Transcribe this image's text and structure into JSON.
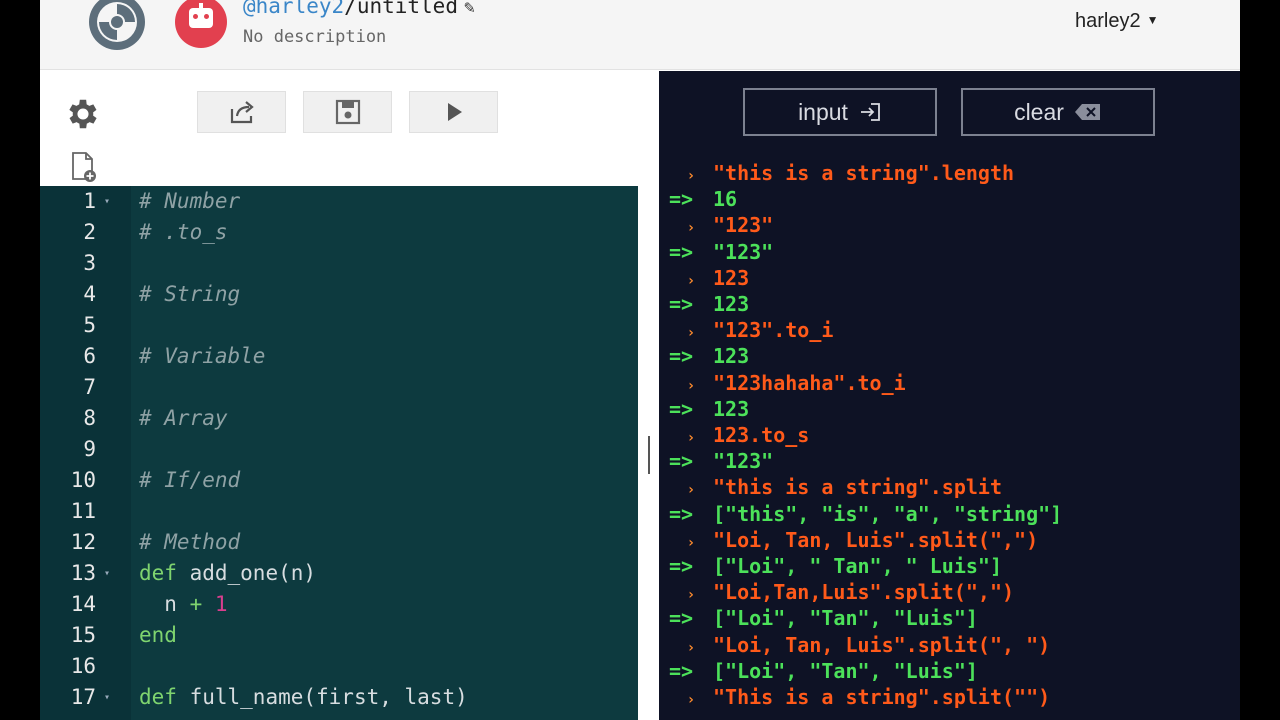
{
  "header": {
    "owner": "@harley2",
    "separator": "/",
    "repl_name": "untitled",
    "description": "No description",
    "username": "harley2"
  },
  "icons": {
    "logo": "logo-icon",
    "avatar": "robot-avatar-icon",
    "edit": "pencil-icon",
    "settings": "gear-icon",
    "new_file": "new-file-icon",
    "share": "share-icon",
    "save": "save-icon",
    "run": "play-icon",
    "input": "input-icon",
    "clear": "backspace-icon"
  },
  "colors": {
    "editor_bg": "#0d3a3f",
    "console_bg": "#0e1225",
    "console_input": "#ff5a1a",
    "console_output": "#4ce15a",
    "avatar": "#e2404f",
    "user_link": "#3a86c8"
  },
  "console_buttons": {
    "input_label": "input",
    "clear_label": "clear"
  },
  "editor": {
    "lines": [
      {
        "n": "1",
        "fold": true,
        "tokens": [
          {
            "t": "# Number",
            "c": "cmt"
          }
        ]
      },
      {
        "n": "2",
        "fold": false,
        "tokens": [
          {
            "t": "# .to_s",
            "c": "cmt"
          }
        ]
      },
      {
        "n": "3",
        "fold": false,
        "tokens": []
      },
      {
        "n": "4",
        "fold": false,
        "tokens": [
          {
            "t": "# String",
            "c": "cmt"
          }
        ]
      },
      {
        "n": "5",
        "fold": false,
        "tokens": []
      },
      {
        "n": "6",
        "fold": false,
        "tokens": [
          {
            "t": "# Variable",
            "c": "cmt"
          }
        ]
      },
      {
        "n": "7",
        "fold": false,
        "tokens": []
      },
      {
        "n": "8",
        "fold": false,
        "tokens": [
          {
            "t": "# Array",
            "c": "cmt"
          }
        ]
      },
      {
        "n": "9",
        "fold": false,
        "tokens": []
      },
      {
        "n": "10",
        "fold": false,
        "tokens": [
          {
            "t": "# If/end",
            "c": "cmt"
          }
        ]
      },
      {
        "n": "11",
        "fold": false,
        "tokens": []
      },
      {
        "n": "12",
        "fold": false,
        "tokens": [
          {
            "t": "# Method",
            "c": "cmt"
          }
        ]
      },
      {
        "n": "13",
        "fold": true,
        "tokens": [
          {
            "t": "def",
            "c": "kw"
          },
          {
            "t": " add_one(n)",
            "c": "fn"
          }
        ]
      },
      {
        "n": "14",
        "fold": false,
        "tokens": [
          {
            "t": "  n ",
            "c": "fn"
          },
          {
            "t": "+",
            "c": "op"
          },
          {
            "t": " ",
            "c": "fn"
          },
          {
            "t": "1",
            "c": "num"
          }
        ]
      },
      {
        "n": "15",
        "fold": false,
        "tokens": [
          {
            "t": "end",
            "c": "kw"
          }
        ]
      },
      {
        "n": "16",
        "fold": false,
        "tokens": []
      },
      {
        "n": "17",
        "fold": true,
        "tokens": [
          {
            "t": "def",
            "c": "kw"
          },
          {
            "t": " full_name(first, last)",
            "c": "fn"
          }
        ]
      }
    ]
  },
  "console": {
    "input_prefix": "›",
    "output_prefix": "=>",
    "lines": [
      {
        "kind": "in",
        "text": "\"this is a string\".length"
      },
      {
        "kind": "out",
        "text": "16"
      },
      {
        "kind": "in",
        "text": "\"123\""
      },
      {
        "kind": "out",
        "text": "\"123\""
      },
      {
        "kind": "in",
        "text": "123"
      },
      {
        "kind": "out",
        "text": "123"
      },
      {
        "kind": "in",
        "text": "\"123\".to_i"
      },
      {
        "kind": "out",
        "text": "123"
      },
      {
        "kind": "in",
        "text": "\"123hahaha\".to_i"
      },
      {
        "kind": "out",
        "text": "123"
      },
      {
        "kind": "in",
        "text": "123.to_s"
      },
      {
        "kind": "out",
        "text": "\"123\""
      },
      {
        "kind": "in",
        "text": "\"this is a string\".split"
      },
      {
        "kind": "out",
        "text": "[\"this\", \"is\", \"a\", \"string\"]"
      },
      {
        "kind": "in",
        "text": "\"Loi, Tan, Luis\".split(\",\")"
      },
      {
        "kind": "out",
        "text": "[\"Loi\", \" Tan\", \" Luis\"]"
      },
      {
        "kind": "in",
        "text": "\"Loi,Tan,Luis\".split(\",\")"
      },
      {
        "kind": "out",
        "text": "[\"Loi\", \"Tan\", \"Luis\"]"
      },
      {
        "kind": "in",
        "text": "\"Loi, Tan, Luis\".split(\", \")"
      },
      {
        "kind": "out",
        "text": "[\"Loi\", \"Tan\", \"Luis\"]"
      },
      {
        "kind": "in",
        "text": "\"This is a string\".split(\"\")"
      }
    ]
  }
}
